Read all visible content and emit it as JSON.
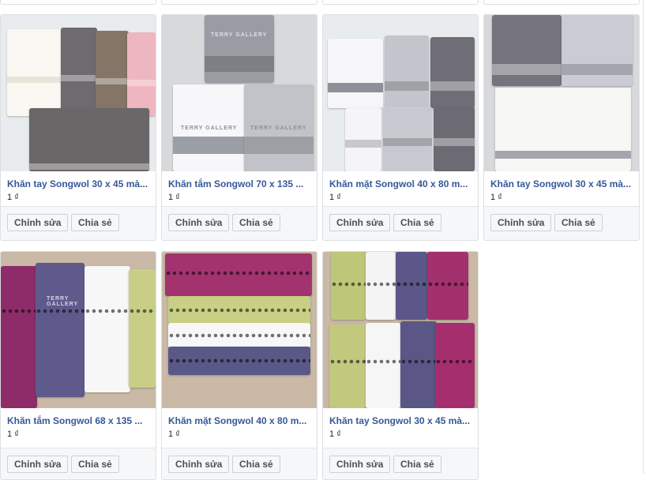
{
  "products": [
    {
      "title": "Khăn tay Songwol 30 x 45 mà...",
      "price": "1 ₫",
      "edit_label": "Chỉnh sửa",
      "share_label": "Chia sẻ"
    },
    {
      "title": "Khăn tắm Songwol 70 x 135 ...",
      "price": "1 ₫",
      "edit_label": "Chỉnh sửa",
      "share_label": "Chia sẻ"
    },
    {
      "title": "Khăn mặt Songwol 40 x 80 m...",
      "price": "1 ₫",
      "edit_label": "Chỉnh sửa",
      "share_label": "Chia sẻ"
    },
    {
      "title": "Khăn tay Songwol 30 x 45 mà...",
      "price": "1 ₫",
      "edit_label": "Chỉnh sửa",
      "share_label": "Chia sẻ"
    },
    {
      "title": "Khăn tắm Songwol 68 x 135 ...",
      "price": "1 ₫",
      "edit_label": "Chỉnh sửa",
      "share_label": "Chia sẻ"
    },
    {
      "title": "Khăn mặt Songwol 40 x 80 m...",
      "price": "1 ₫",
      "edit_label": "Chỉnh sửa",
      "share_label": "Chia sẻ"
    },
    {
      "title": "Khăn tay Songwol 30 x 45 mà...",
      "price": "1 ₫",
      "edit_label": "Chỉnh sửa",
      "share_label": "Chia sẻ"
    }
  ],
  "photo_logo": "TERRY GALLERY",
  "colors": {
    "title_link": "#365899",
    "button_text": "#4b4f56",
    "button_bg": "#f6f7f9",
    "border": "#dddfe2"
  }
}
